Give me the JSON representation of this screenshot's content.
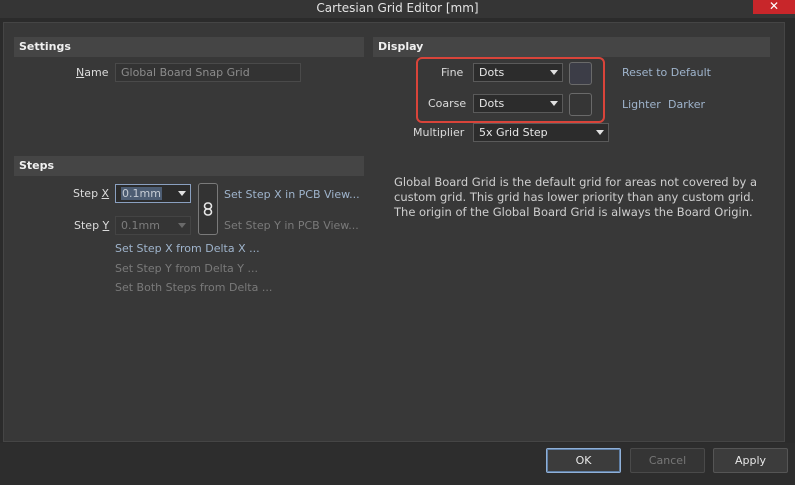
{
  "window": {
    "title": "Cartesian Grid Editor [mm]",
    "close_label": "✕"
  },
  "settings": {
    "header": "Settings",
    "name_label": "Name",
    "name_value": "Global Board Snap Grid"
  },
  "display": {
    "header": "Display",
    "fine_label": "Fine",
    "fine_value": "Dots",
    "fine_color": "#3c3d47",
    "coarse_label": "Coarse",
    "coarse_value": "Dots",
    "coarse_color": "#363636",
    "multiplier_label": "Multiplier",
    "multiplier_value": "5x Grid Step",
    "reset_label": "Reset to Default",
    "lighter_label": "Lighter",
    "darker_label": "Darker",
    "highlight_color": "#d9443a"
  },
  "steps": {
    "header": "Steps",
    "step_x_label_prefix": "Step ",
    "step_x_label_key": "X",
    "step_x_value": "0.1mm",
    "step_y_label_prefix": "Step ",
    "step_y_label_key": "Y",
    "step_y_value": "0.1mm",
    "set_x_pcb": "Set Step X in PCB View...",
    "set_y_pcb": "Set Step Y in PCB View...",
    "set_x_delta": "Set Step X from Delta X ...",
    "set_y_delta": "Set Step Y from Delta Y ...",
    "set_both_delta": "Set Both Steps from Delta ..."
  },
  "description": "Global Board Grid is the default grid for areas not covered by a custom grid. This grid has lower priority than any custom grid. The origin of the Global Board Grid is always the Board Origin.",
  "buttons": {
    "ok": "OK",
    "cancel": "Cancel",
    "apply": "Apply"
  }
}
